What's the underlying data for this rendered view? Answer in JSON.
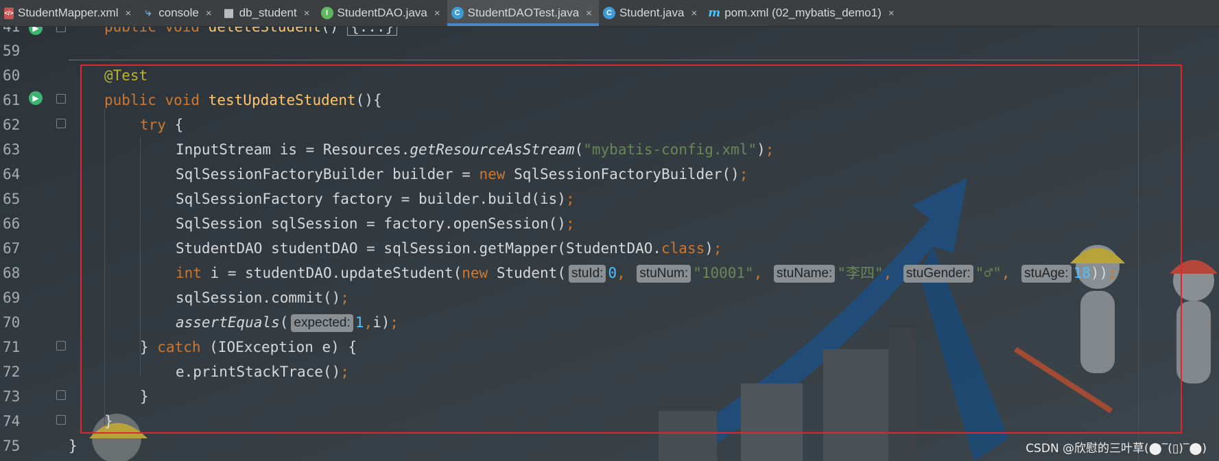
{
  "tabs": [
    {
      "label": "StudentMapper.xml",
      "icon": "xml-file-icon",
      "glyph": "</>",
      "active": false
    },
    {
      "label": "console",
      "icon": "console-icon",
      "glyph": "⤷",
      "active": false
    },
    {
      "label": "db_student",
      "icon": "table-icon",
      "glyph": "▦",
      "active": false
    },
    {
      "label": "StudentDAO.java",
      "icon": "interface-icon",
      "glyph": "I",
      "active": false
    },
    {
      "label": "StudentDAOTest.java",
      "icon": "class-icon",
      "glyph": "C",
      "active": true
    },
    {
      "label": "Student.java",
      "icon": "class-icon",
      "glyph": "C",
      "active": false
    },
    {
      "label": "pom.xml (02_mybatis_demo1)",
      "icon": "maven-icon",
      "glyph": "m",
      "active": false
    }
  ],
  "tab_close_glyph": "×",
  "run_glyph": "▶",
  "line_numbers": [
    "41",
    "59",
    "60",
    "61",
    "62",
    "63",
    "64",
    "65",
    "66",
    "67",
    "68",
    "69",
    "70",
    "71",
    "72",
    "73",
    "74",
    "75"
  ],
  "code": {
    "l41": {
      "kw": "public void",
      "fn": "deleteStudent",
      "paren": "()",
      "fold": "{...}"
    },
    "l60": {
      "ann": "@Test"
    },
    "l61": {
      "kw": "public void",
      "fn": "testUpdateStudent",
      "rest": "(){"
    },
    "l62": {
      "kw": "try",
      "rest": " {"
    },
    "l63": {
      "a": "InputStream is = Resources.",
      "b": "getResourceAsStream",
      "c": "(",
      "str": "\"mybatis-config.xml\"",
      "d": ")",
      "semi": ";"
    },
    "l64": {
      "a": "SqlSessionFactoryBuilder builder = ",
      "kw": "new",
      "b": " SqlSessionFactoryBuilder()",
      "semi": ";"
    },
    "l65": {
      "a": "SqlSessionFactory factory = builder.build(is)",
      "semi": ";"
    },
    "l66": {
      "a": "SqlSession sqlSession = factory.openSession()",
      "semi": ";"
    },
    "l67": {
      "a": "StudentDAO studentDAO = sqlSession.getMapper(StudentDAO.",
      "kw": "class",
      "b": ")",
      "semi": ";"
    },
    "l68": {
      "kw1": "int",
      "a": " i = studentDAO.updateStudent(",
      "kw2": "new",
      "b": " Student(",
      "h1": "stuId:",
      "v1": "0",
      "h2": "stuNum:",
      "v2": "\"10001\"",
      "h3": "stuName:",
      "v3": "\"李四\"",
      "h4": "stuGender:",
      "v4": "\"♂\"",
      "h5": "stuAge:",
      "v5": "18",
      "c": "))",
      "semi": ";",
      "comma": ","
    },
    "l69": {
      "a": "sqlSession.commit()",
      "semi": ";"
    },
    "l70": {
      "it": "assertEquals",
      "a": "(",
      "h": "expected:",
      "v": "1",
      "comma": ",",
      "b": "i)",
      "semi": ";"
    },
    "l71": {
      "a": "} ",
      "kw": "catch",
      "b": " (IOException e) {"
    },
    "l72": {
      "a": "e.printStackTrace()",
      "semi": ";"
    },
    "l73": {
      "a": "}"
    },
    "l74": {
      "a": "}"
    },
    "l75": {
      "a": "}"
    }
  },
  "watermark": "CSDN @欣慰的三叶草(⬤‾(▯)‾⬤)",
  "colors": {
    "keyword": "#cc7832",
    "annotation": "#bbb529",
    "method": "#ffc66d",
    "string": "#6a8759",
    "number": "#4fc1ff",
    "highlight_box": "#e0262d",
    "active_tab_underline": "#4a88c7"
  }
}
